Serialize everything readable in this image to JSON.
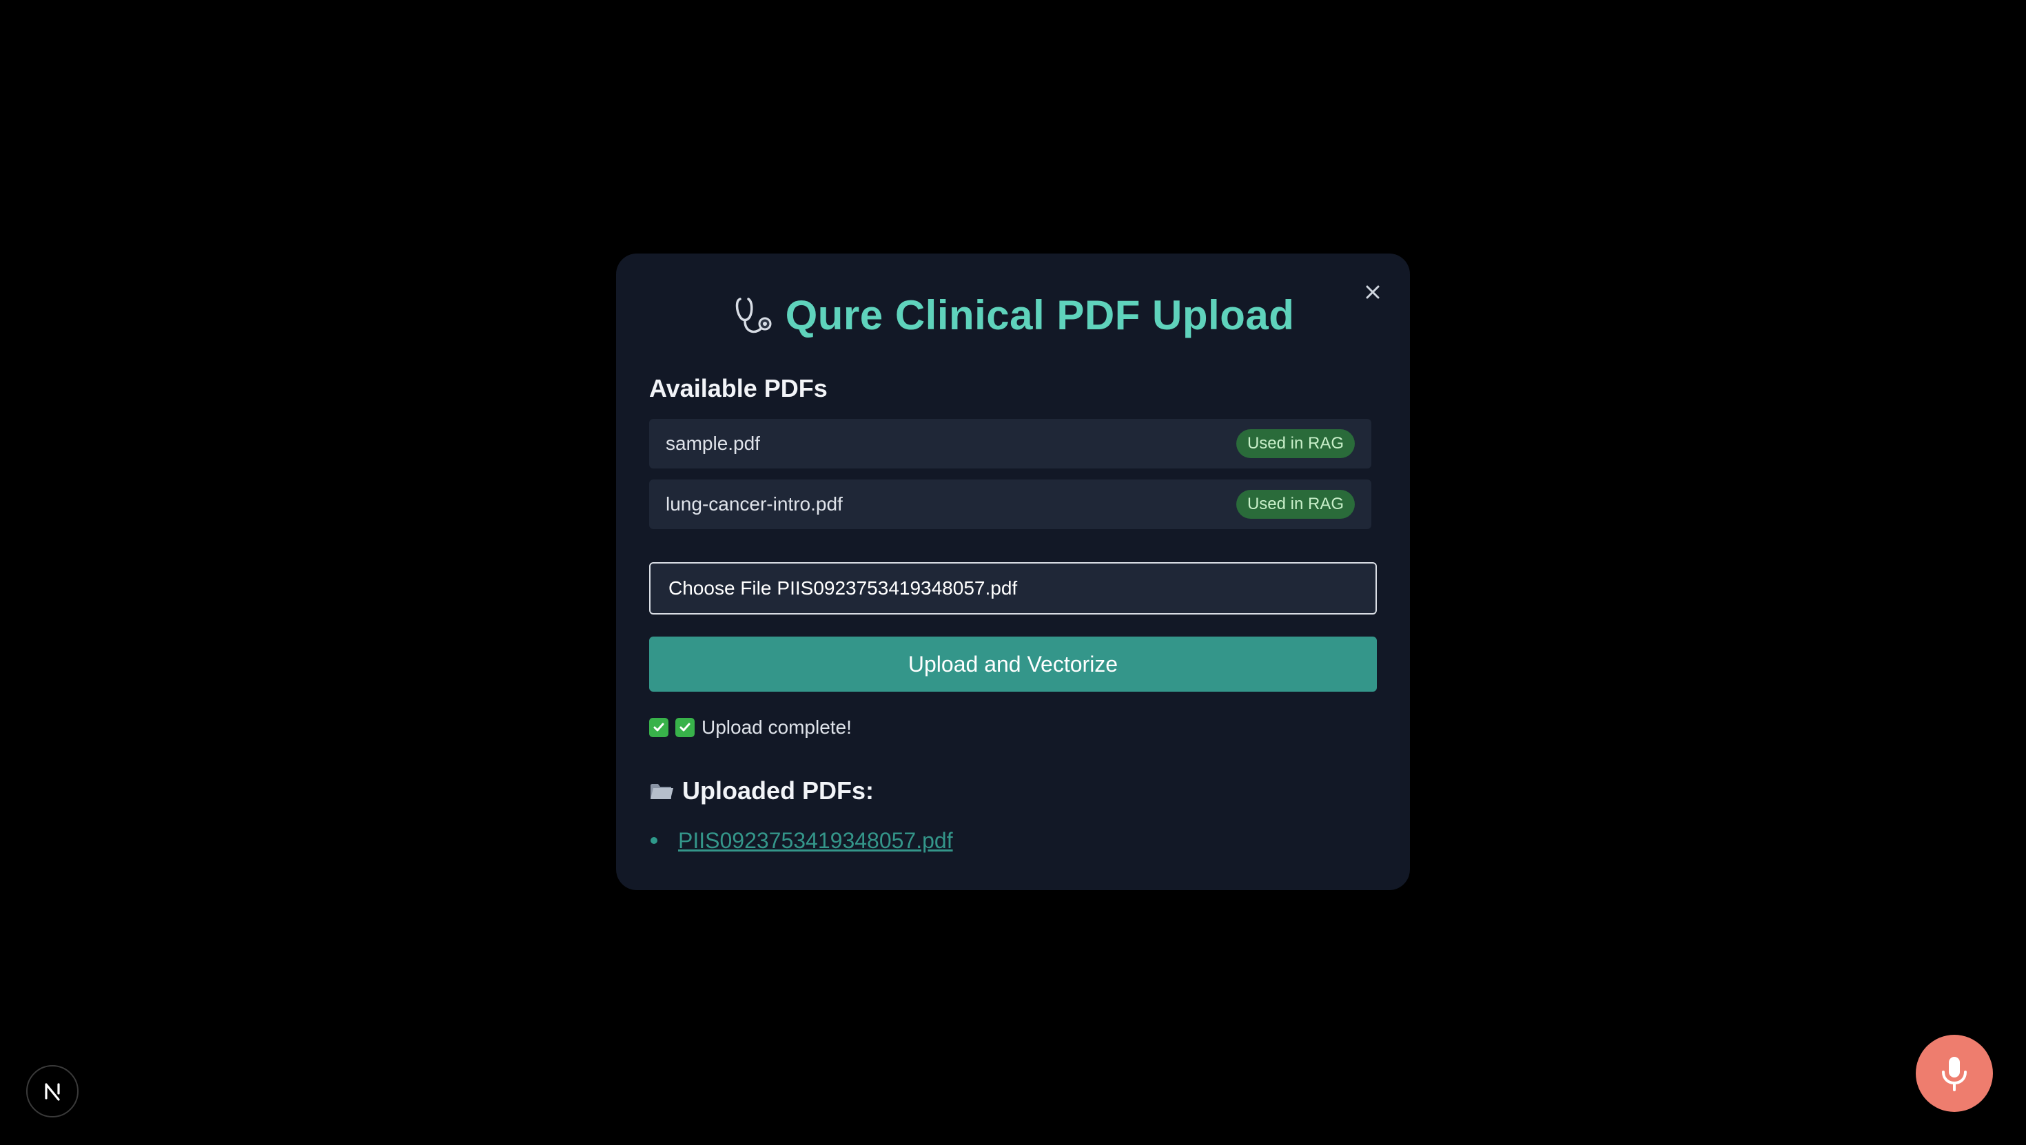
{
  "modal": {
    "title": "Qure Clinical PDF Upload",
    "title_icon": "stethoscope-icon",
    "close_label": "×",
    "available_heading": "Available PDFs",
    "available_pdfs": [
      {
        "name": "sample.pdf",
        "badge": "Used in RAG"
      },
      {
        "name": "lung-cancer-intro.pdf",
        "badge": "Used in RAG"
      }
    ],
    "file_input": {
      "button_label": "Choose File",
      "file_name": "PIIS0923753419348057.pdf"
    },
    "upload_button_label": "Upload and Vectorize",
    "status_text": "Upload complete!",
    "uploaded_heading": "Uploaded PDFs:",
    "uploaded_pdfs": [
      "PIIS0923753419348057.pdf"
    ]
  },
  "colors": {
    "background": "#000000",
    "modal_bg": "#121826",
    "accent": "#5fd3bc",
    "button": "#34968a",
    "badge_bg": "#2a6b3a",
    "mic_button": "#ee7d6e"
  },
  "icons": {
    "close": "close-icon",
    "check": "check-icon",
    "folder": "folder-icon",
    "next_logo": "nextjs-icon",
    "microphone": "microphone-icon"
  }
}
